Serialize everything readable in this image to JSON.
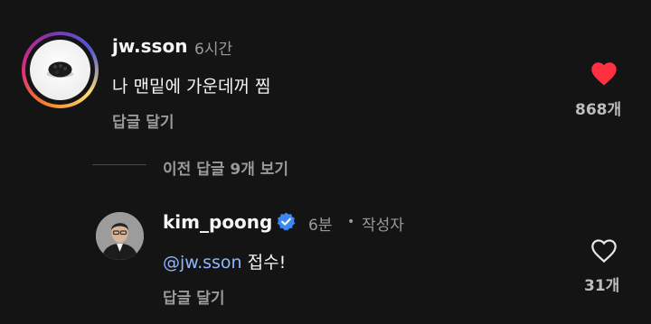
{
  "comments": [
    {
      "username": "jw.sson",
      "time": "6시간",
      "text": "나 맨밑에 가운데꺼 찜",
      "reply_label": "답글 달기",
      "likes": "868개",
      "liked": true,
      "like_color": "#ff3040"
    },
    {
      "username": "kim_poong",
      "verified": true,
      "time": "6분",
      "separator": "•",
      "author_badge": "작성자",
      "mention": "@jw.sson",
      "text": "접수!",
      "reply_label": "답글 달기",
      "likes": "31개",
      "liked": false
    }
  ],
  "view_previous_replies": "이전 답글 9개 보기",
  "colors": {
    "background": "#141414",
    "mention": "#8fb6ff",
    "verified": "#3b88f0"
  }
}
